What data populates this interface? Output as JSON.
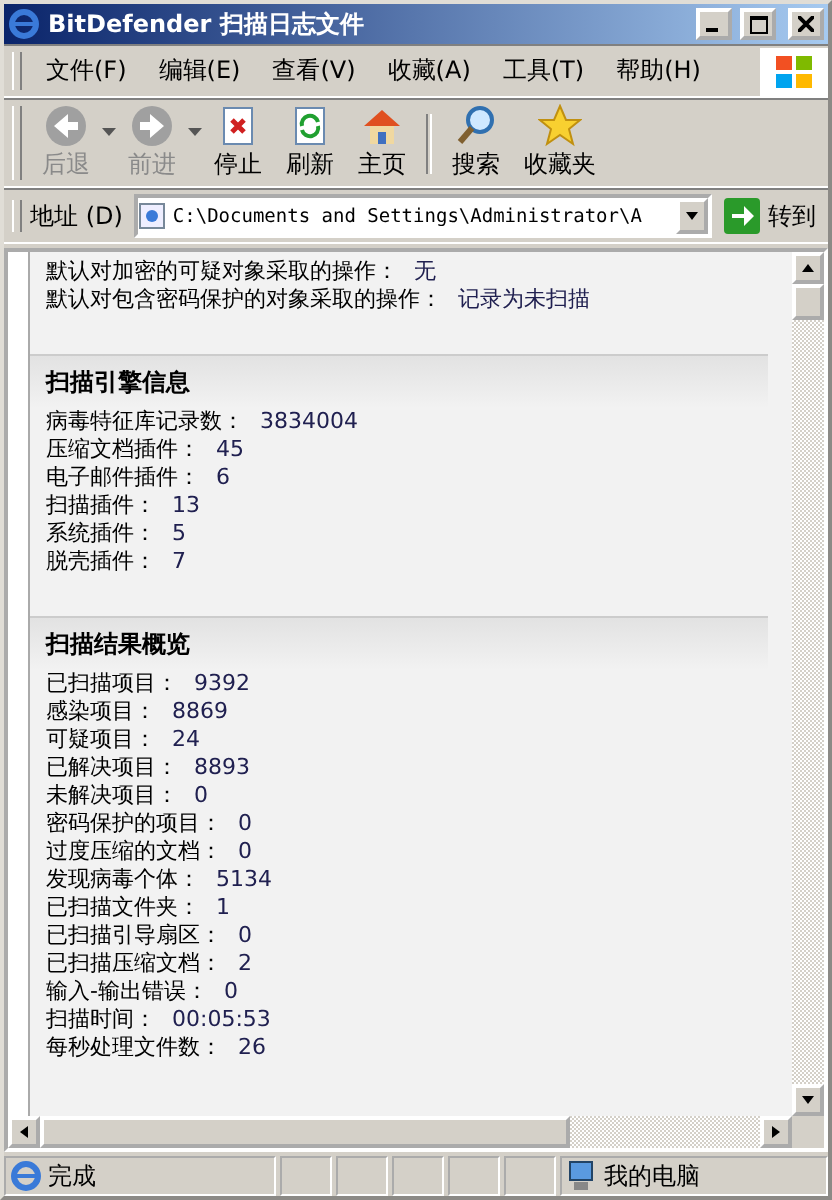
{
  "window": {
    "title": "BitDefender 扫描日志文件"
  },
  "menu": [
    "文件(F)",
    "编辑(E)",
    "查看(V)",
    "收藏(A)",
    "工具(T)",
    "帮助(H)"
  ],
  "toolbar": [
    {
      "kind": "back",
      "label": "后退",
      "disabled": true
    },
    {
      "kind": "forward",
      "label": "前进",
      "disabled": true
    },
    {
      "kind": "stop",
      "label": "停止",
      "disabled": false
    },
    {
      "kind": "refresh",
      "label": "刷新",
      "disabled": false
    },
    {
      "kind": "home",
      "label": "主页",
      "disabled": false
    },
    {
      "kind": "search",
      "label": "搜索",
      "disabled": false
    },
    {
      "kind": "favorites",
      "label": "收藏夹",
      "disabled": false
    }
  ],
  "address": {
    "label": "地址 (D)",
    "value": "C:\\Documents and Settings\\Administrator\\A",
    "go": "转到"
  },
  "content": {
    "lines": [
      {
        "label": "默认对加密的可疑对象采取的操作：",
        "value": "无"
      },
      {
        "label": "默认对包含密码保护的对象采取的操作：",
        "value": "记录为未扫描"
      }
    ],
    "sections": [
      {
        "title": "扫描引擎信息",
        "rows": [
          {
            "label": "病毒特征库记录数：",
            "value": "3834004"
          },
          {
            "label": "压缩文档插件：",
            "value": "45"
          },
          {
            "label": "电子邮件插件：",
            "value": "6"
          },
          {
            "label": "扫描插件：",
            "value": "13"
          },
          {
            "label": "系统插件：",
            "value": "5"
          },
          {
            "label": "脱壳插件：",
            "value": "7"
          }
        ]
      },
      {
        "title": "扫描结果概览",
        "rows": [
          {
            "label": "已扫描项目：",
            "value": "9392"
          },
          {
            "label": "感染项目：",
            "value": "8869"
          },
          {
            "label": "可疑项目：",
            "value": "24"
          },
          {
            "label": "已解决项目：",
            "value": "8893"
          },
          {
            "label": "未解决项目：",
            "value": "0"
          },
          {
            "label": "密码保护的项目：",
            "value": "0"
          },
          {
            "label": "过度压缩的文档：",
            "value": "0"
          },
          {
            "label": "发现病毒个体：",
            "value": "5134"
          },
          {
            "label": "已扫描文件夹：",
            "value": "1"
          },
          {
            "label": "已扫描引导扇区：",
            "value": "0"
          },
          {
            "label": "已扫描压缩文档：",
            "value": "2"
          },
          {
            "label": "输入-输出错误：",
            "value": "0"
          },
          {
            "label": "扫描时间：",
            "value": "00:05:53"
          },
          {
            "label": "每秒处理文件数：",
            "value": "26"
          }
        ]
      }
    ]
  },
  "status_bar": {
    "text": "完成",
    "zone": "我的电脑"
  }
}
